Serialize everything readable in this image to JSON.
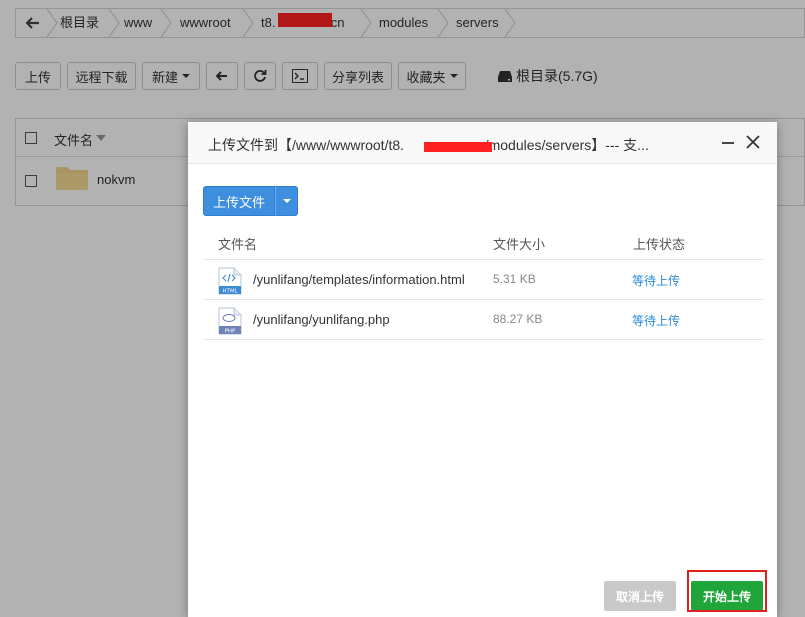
{
  "breadcrumb": {
    "items": [
      "根目录",
      "www",
      "wwwroot",
      "t8.",
      "t.cn",
      "modules",
      "servers"
    ]
  },
  "toolbar": {
    "upload": "上传",
    "remote_download": "远程下载",
    "new": "新建",
    "share_list": "分享列表",
    "favorites": "收藏夹",
    "disk_label": "根目录(5.7G)"
  },
  "file_list": {
    "column_name": "文件名",
    "items": [
      {
        "name": "nokvm"
      }
    ]
  },
  "dialog": {
    "title": "上传文件到【/www/wwwroot/t8.",
    "title_suffix": ".cn/modules/servers】--- 支...",
    "upload_button": "上传文件",
    "columns": {
      "name": "文件名",
      "size": "文件大小",
      "status": "上传状态"
    },
    "files": [
      {
        "name": "/yunlifang/templates/information.html",
        "size": "5.31 KB",
        "status": "等待上传",
        "icon": "html-file-icon",
        "icon_label": "HTML"
      },
      {
        "name": "/yunlifang/yunlifang.php",
        "size": "88.27 KB",
        "status": "等待上传",
        "icon": "php-file-icon",
        "icon_label": "PHP"
      }
    ],
    "cancel_button": "取消上传",
    "start_button": "开始上传"
  },
  "colors": {
    "primary": "#3e8fe0",
    "start": "#20a53a",
    "cancel": "#c9c9c9",
    "link": "#2e8bd8",
    "redaction": "#ff2020",
    "highlight": "#e02020"
  }
}
